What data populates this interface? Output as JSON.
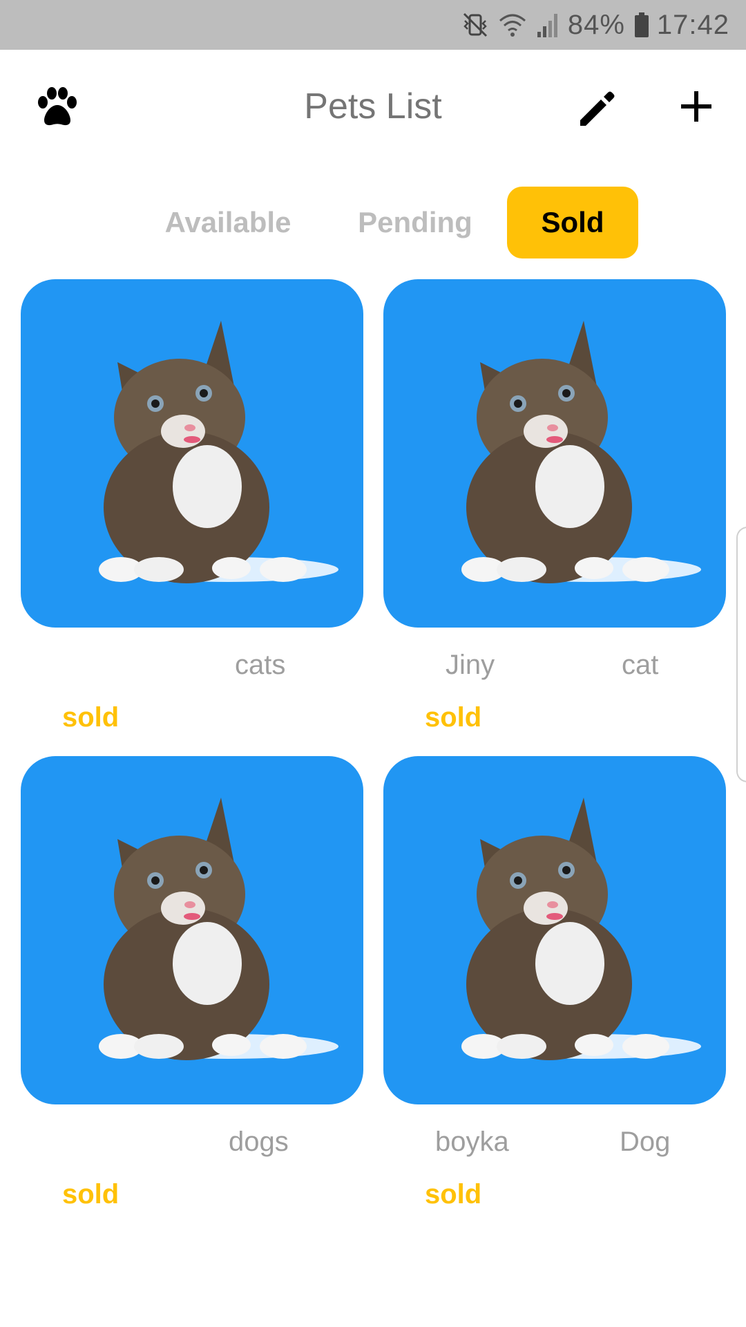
{
  "status_bar": {
    "battery": "84%",
    "time": "17:42",
    "icons": [
      "vibrate-mute-icon",
      "wifi-icon",
      "signal-icon",
      "battery-icon"
    ]
  },
  "header": {
    "title": "Pets List",
    "left_icon": "paw-icon",
    "actions": [
      "edit-icon",
      "add-icon"
    ]
  },
  "tabs": [
    {
      "label": "Available",
      "active": false
    },
    {
      "label": "Pending",
      "active": false
    },
    {
      "label": "Sold",
      "active": true
    }
  ],
  "pets": [
    {
      "name": "",
      "category": "cats",
      "status": "sold"
    },
    {
      "name": "Jiny",
      "category": "cat",
      "status": "sold"
    },
    {
      "name": "",
      "category": "dogs",
      "status": "sold"
    },
    {
      "name": "boyka",
      "category": "Dog",
      "status": "sold"
    }
  ],
  "colors": {
    "accent": "#ffc107",
    "card_background": "#2196f3",
    "status_bar": "#bdbdbd",
    "muted_text": "#9e9e9e"
  }
}
